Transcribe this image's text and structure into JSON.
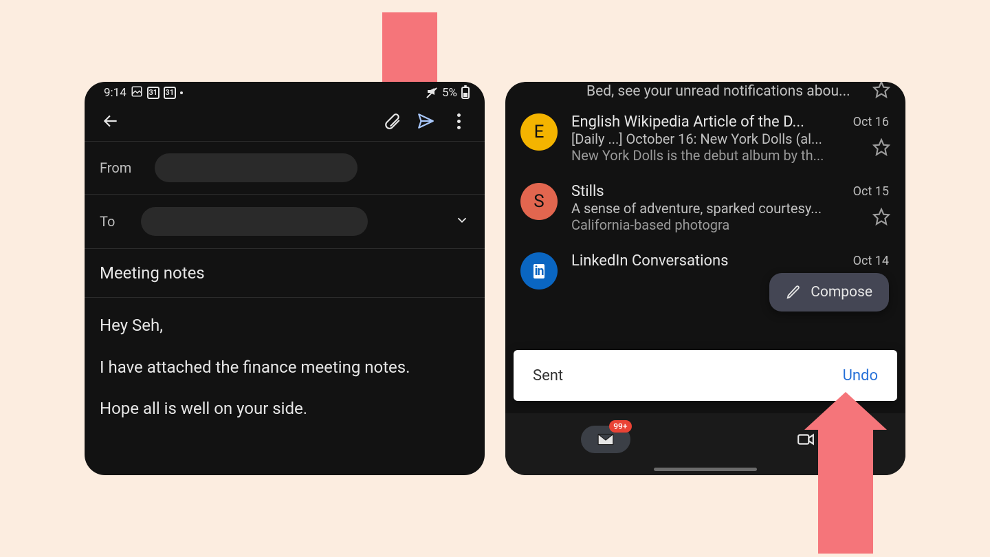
{
  "status_bar": {
    "time": "9:14",
    "cal_day": "31",
    "battery_pct": "5%"
  },
  "compose": {
    "from_label": "From",
    "to_label": "To",
    "subject": "Meeting notes",
    "body_line1": "Hey Seh,",
    "body_line2": "I have attached the finance meeting notes.",
    "body_line3": "Hope all is well on your side."
  },
  "inbox": {
    "partial_top_snippet": "Bed, see your unread notifications abou...",
    "items": [
      {
        "avatar_letter": "E",
        "avatar_color": "#f4b400",
        "sender": "English Wikipedia Article of the D...",
        "subject": "[Daily ...] October 16: New York Dolls (al...",
        "snippet": "New York Dolls is the debut album by th...",
        "date": "Oct 16"
      },
      {
        "avatar_letter": "S",
        "avatar_color": "#e2664f",
        "sender": "Stills",
        "subject": "A sense of adventure, sparked courtesy...",
        "snippet": "California-based photogra",
        "date": "Oct 15"
      },
      {
        "avatar_letter": "in",
        "avatar_color": "#0a66c2",
        "sender": "LinkedIn Conversations",
        "subject": "",
        "snippet": "",
        "date": "Oct 14"
      }
    ],
    "compose_label": "Compose",
    "snackbar_msg": "Sent",
    "snackbar_action": "Undo",
    "nav_badge": "99+"
  }
}
